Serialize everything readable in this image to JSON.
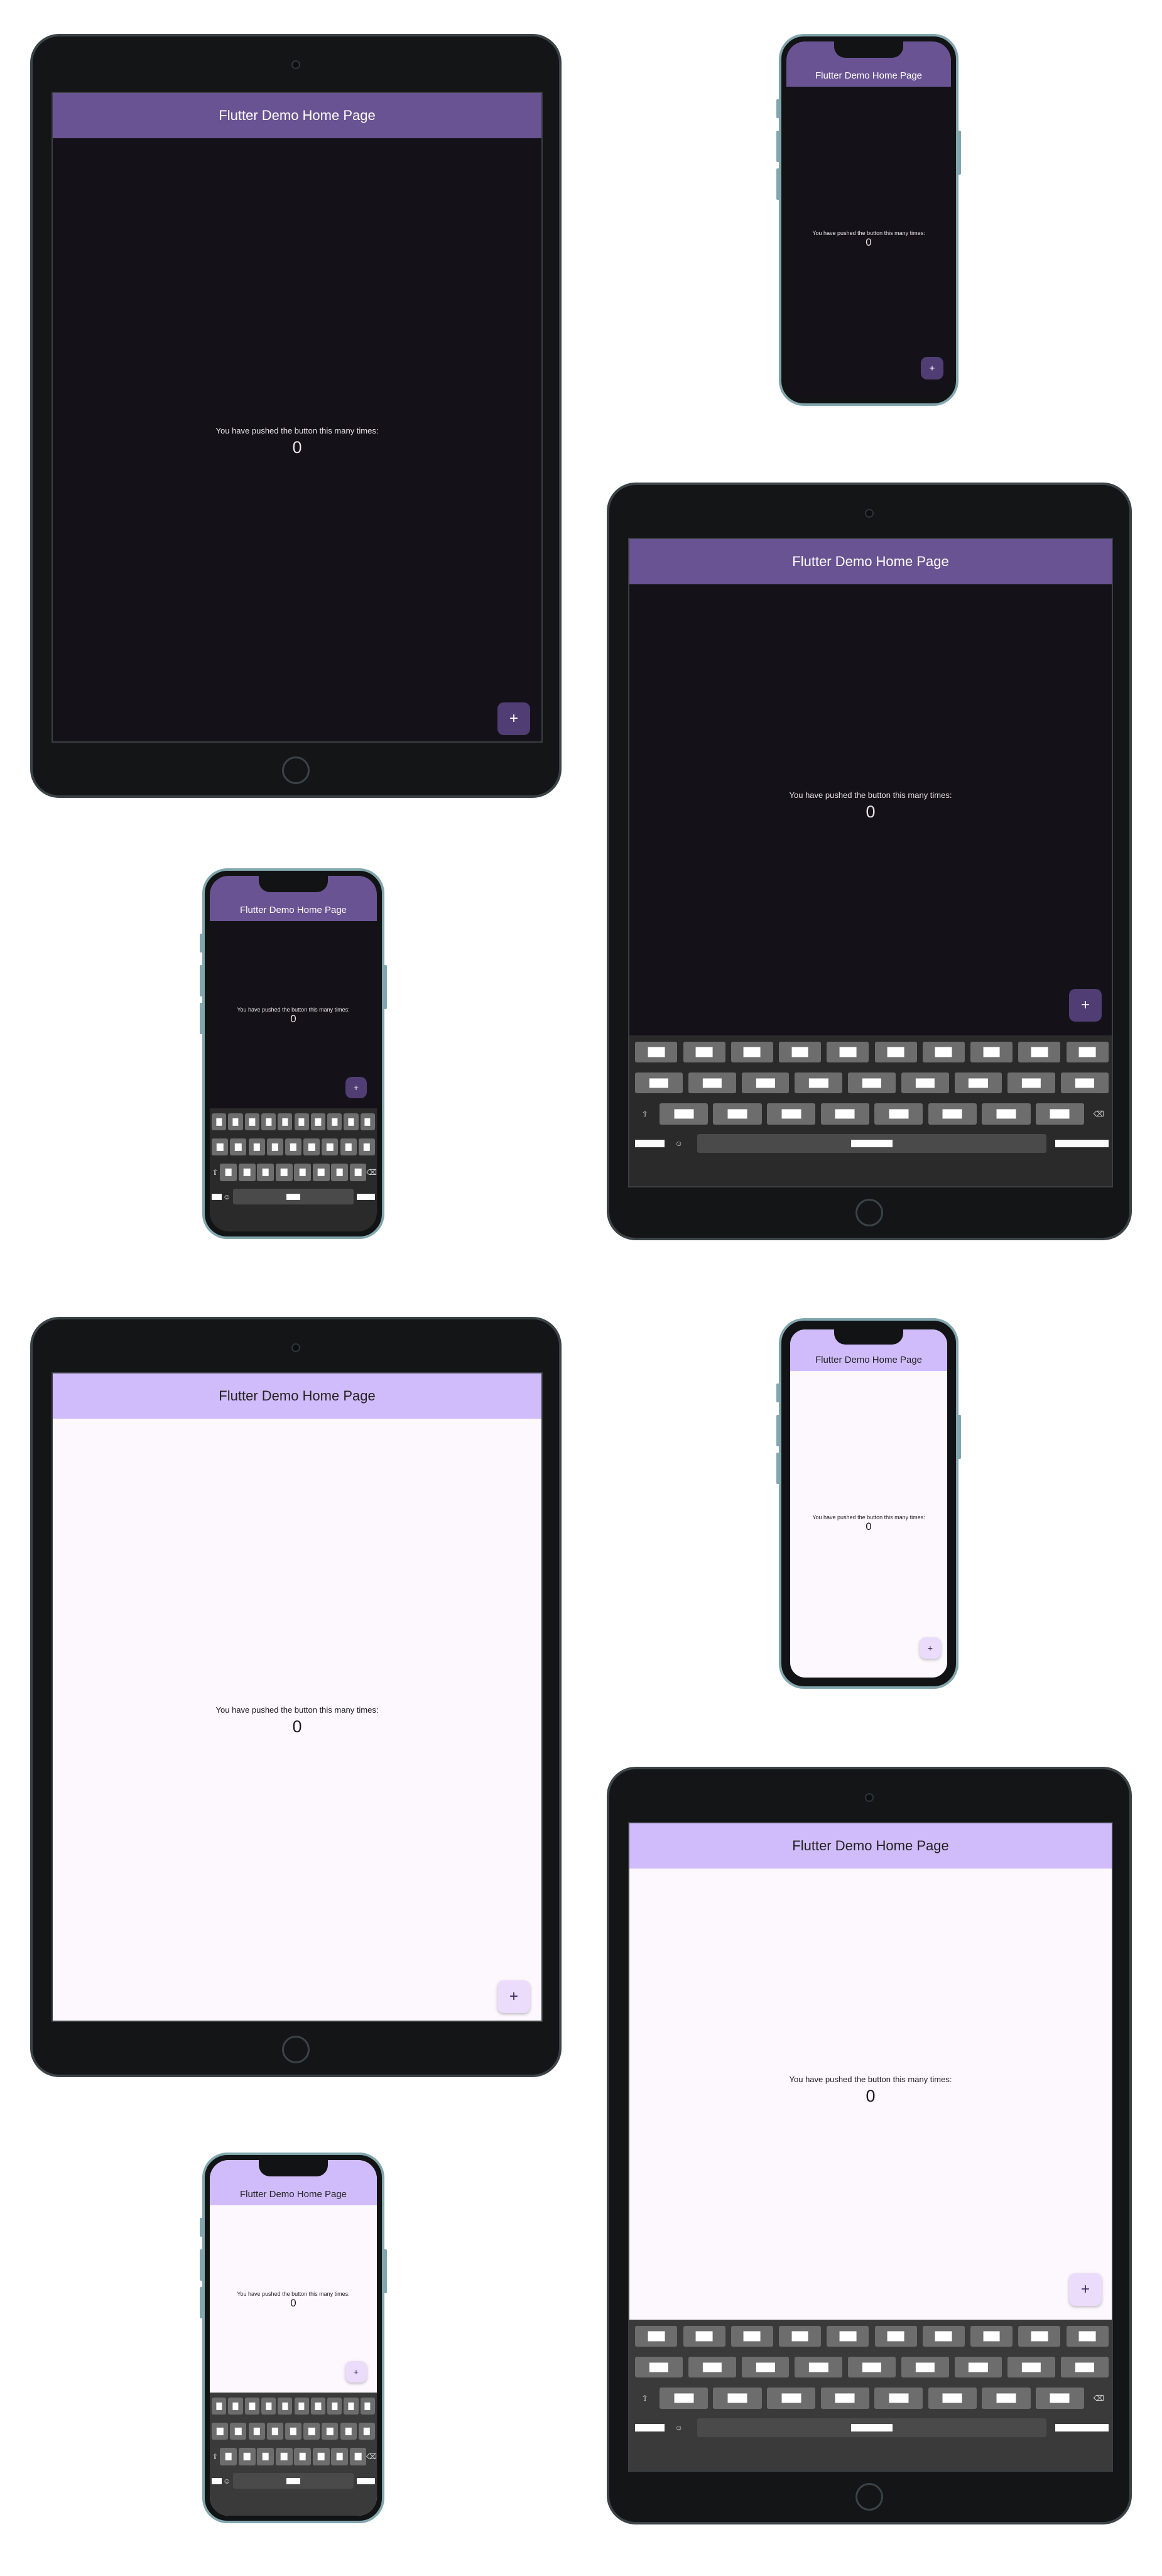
{
  "app": {
    "title": "Flutter Demo Home Page",
    "counter_message": "You have pushed the button this many times:",
    "counter_value": "0",
    "fab_label": "+"
  },
  "keyboard": {
    "shift_glyph": "⇧",
    "emoji_glyph": "☺",
    "backspace_glyph": "⌫"
  },
  "colors": {
    "dark_appbar": "#6a5393",
    "dark_background": "#141218",
    "dark_fab": "#4f3d74",
    "light_appbar": "#d1bcfb",
    "light_background": "#fdf7fe",
    "light_fab": "#eadcfa",
    "iphone_frame": "#82a6ad",
    "ipad_frame": "#3c4346"
  }
}
